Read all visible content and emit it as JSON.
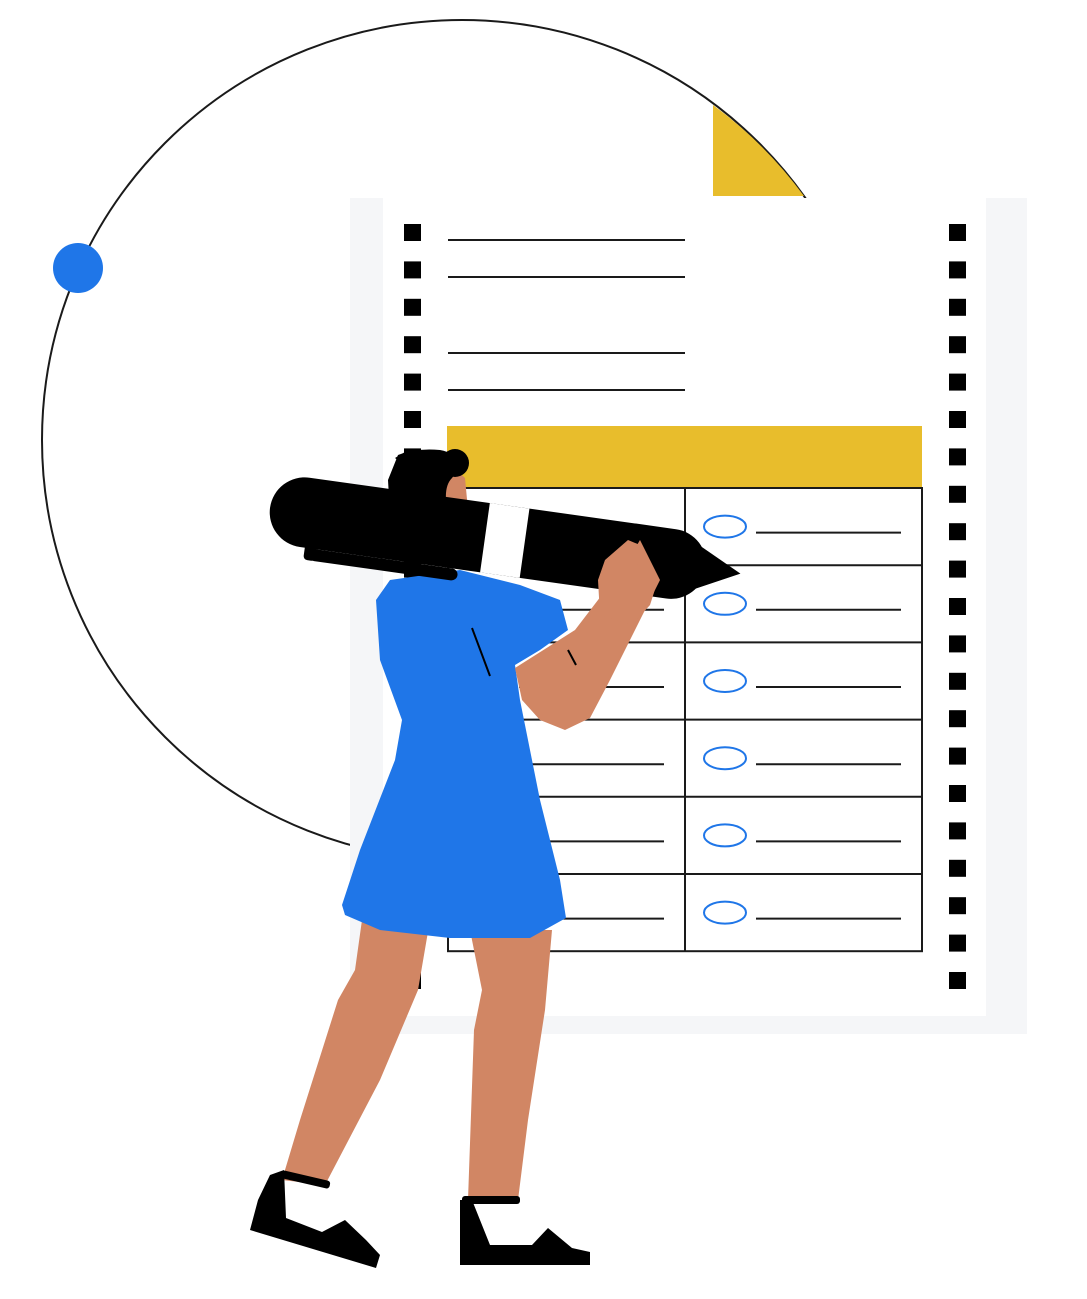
{
  "illustration": {
    "subject": "person-carrying-giant-pen-beside-ballot",
    "colors": {
      "background": "#ffffff",
      "paper_shadow": "#f5f6f8",
      "paper": "#ffffff",
      "accent_yellow": "#e8bd2c",
      "accent_blue": "#1f76e8",
      "ink": "#000000",
      "skin": "#d18664",
      "dress": "#1f76e8",
      "ballot_oval": "#1f76e8"
    },
    "ballot": {
      "header_lines": 4,
      "rows": 6,
      "columns": 2,
      "marked_option": "right-column-row-2"
    }
  }
}
